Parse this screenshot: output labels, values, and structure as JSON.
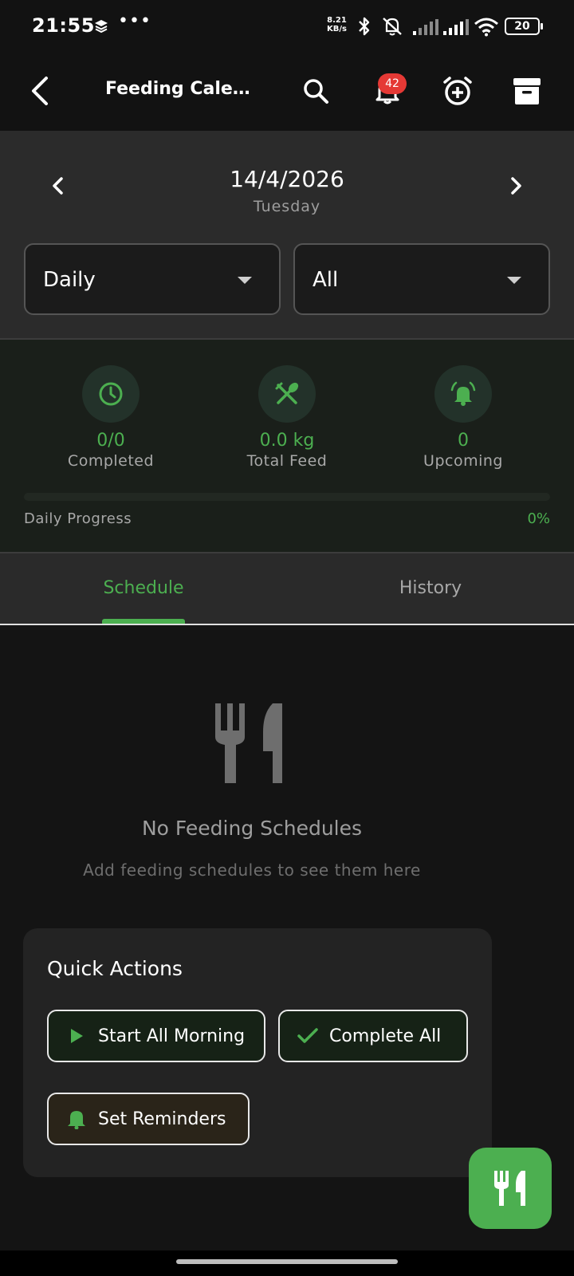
{
  "status_bar": {
    "time": "21:55",
    "dots": "•••",
    "net_speed_value": "8.21",
    "net_speed_unit": "KB/s",
    "battery": "20"
  },
  "app_bar": {
    "title": "Feeding Calend...",
    "notification_count": "42",
    "icons": [
      "back-arrow-icon",
      "search-icon",
      "notification-bell-icon",
      "add-alarm-icon",
      "archive-icon"
    ]
  },
  "date_header": {
    "date": "14/4/2026",
    "weekday": "Tuesday",
    "view_dropdown": "Daily",
    "filter_dropdown": "All"
  },
  "stats": {
    "completed": {
      "value": "0/0",
      "label": "Completed",
      "icon": "clock-icon"
    },
    "total_feed": {
      "value": "0.0 kg",
      "label": "Total Feed",
      "icon": "utensils-icon"
    },
    "upcoming": {
      "value": "0",
      "label": "Upcoming",
      "icon": "alarm-bell-icon"
    },
    "progress_label": "Daily Progress",
    "progress_text": "0%",
    "progress_fraction": 0
  },
  "tabs": [
    {
      "label": "Schedule",
      "active": true
    },
    {
      "label": "History",
      "active": false
    }
  ],
  "empty_state": {
    "title": "No Feeding Schedules",
    "subtitle": "Add feeding schedules to see them here"
  },
  "quick_actions": {
    "title": "Quick Actions",
    "buttons": [
      {
        "label": "Start All Morning",
        "icon": "play-icon"
      },
      {
        "label": "Complete All",
        "icon": "check-icon"
      },
      {
        "label": "Set Reminders",
        "icon": "bell-icon"
      }
    ]
  },
  "colors": {
    "accent": "#4caf50",
    "badge": "#e53935",
    "background": "#141414"
  }
}
